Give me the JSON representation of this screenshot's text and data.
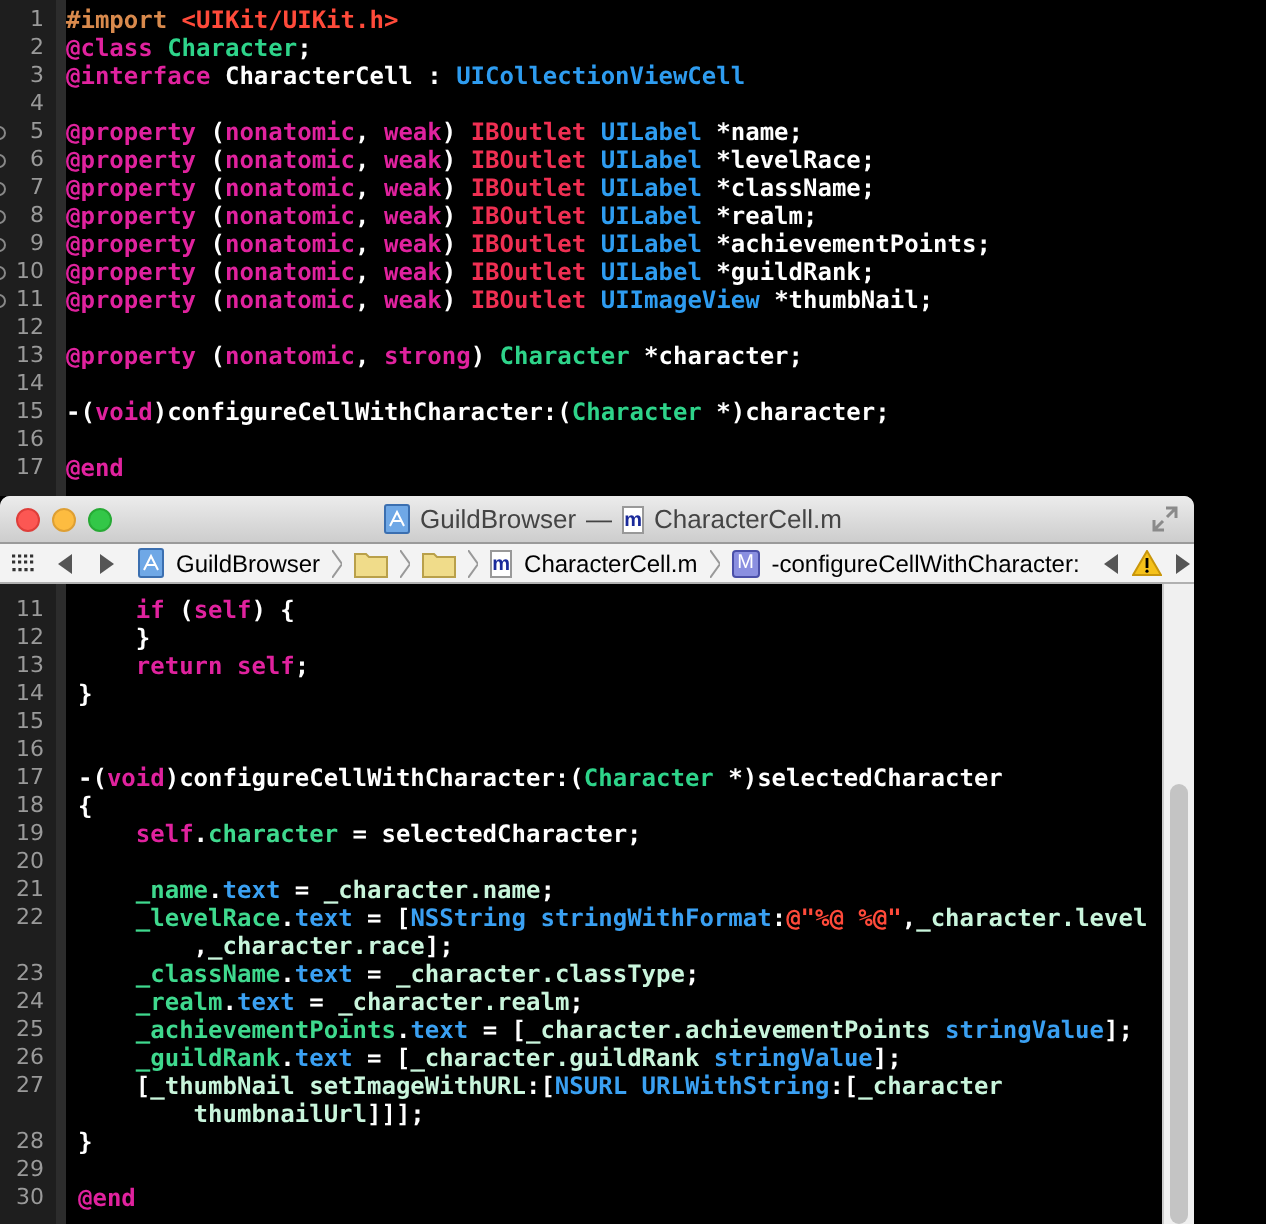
{
  "header_editor": {
    "lines": [
      {
        "n": "1",
        "segs": [
          {
            "text": "#import ",
            "kind": "d"
          },
          {
            "text": "<UIKit/UIKit.h>",
            "kind": "s"
          }
        ]
      },
      {
        "n": "2",
        "segs": [
          {
            "text": "@class ",
            "kind": "k"
          },
          {
            "text": "Character",
            "kind": "p"
          },
          {
            "text": ";",
            "kind": "t"
          }
        ]
      },
      {
        "n": "3",
        "segs": [
          {
            "text": "@interface",
            "kind": "k"
          },
          {
            "text": " CharacterCell : ",
            "kind": "t"
          },
          {
            "text": "UICollectionViewCell",
            "kind": "c"
          }
        ]
      },
      {
        "n": "4"
      },
      {
        "n": "5",
        "outlet": true,
        "segs": [
          {
            "text": "@property",
            "kind": "k"
          },
          {
            "text": " (",
            "kind": "t"
          },
          {
            "text": "nonatomic",
            "kind": "k"
          },
          {
            "text": ", ",
            "kind": "t"
          },
          {
            "text": "weak",
            "kind": "k"
          },
          {
            "text": ") ",
            "kind": "t"
          },
          {
            "text": "IBOutlet ",
            "kind": "o"
          },
          {
            "text": "UILabel",
            "kind": "c"
          },
          {
            "text": " *name;",
            "kind": "t"
          }
        ]
      },
      {
        "n": "6",
        "outlet": true,
        "segs": [
          {
            "text": "@property",
            "kind": "k"
          },
          {
            "text": " (",
            "kind": "t"
          },
          {
            "text": "nonatomic",
            "kind": "k"
          },
          {
            "text": ", ",
            "kind": "t"
          },
          {
            "text": "weak",
            "kind": "k"
          },
          {
            "text": ") ",
            "kind": "t"
          },
          {
            "text": "IBOutlet ",
            "kind": "o"
          },
          {
            "text": "UILabel",
            "kind": "c"
          },
          {
            "text": " *levelRace;",
            "kind": "t"
          }
        ]
      },
      {
        "n": "7",
        "outlet": true,
        "segs": [
          {
            "text": "@property",
            "kind": "k"
          },
          {
            "text": " (",
            "kind": "t"
          },
          {
            "text": "nonatomic",
            "kind": "k"
          },
          {
            "text": ", ",
            "kind": "t"
          },
          {
            "text": "weak",
            "kind": "k"
          },
          {
            "text": ") ",
            "kind": "t"
          },
          {
            "text": "IBOutlet ",
            "kind": "o"
          },
          {
            "text": "UILabel",
            "kind": "c"
          },
          {
            "text": " *className;",
            "kind": "t"
          }
        ]
      },
      {
        "n": "8",
        "outlet": true,
        "segs": [
          {
            "text": "@property",
            "kind": "k"
          },
          {
            "text": " (",
            "kind": "t"
          },
          {
            "text": "nonatomic",
            "kind": "k"
          },
          {
            "text": ", ",
            "kind": "t"
          },
          {
            "text": "weak",
            "kind": "k"
          },
          {
            "text": ") ",
            "kind": "t"
          },
          {
            "text": "IBOutlet ",
            "kind": "o"
          },
          {
            "text": "UILabel",
            "kind": "c"
          },
          {
            "text": " *realm;",
            "kind": "t"
          }
        ]
      },
      {
        "n": "9",
        "outlet": true,
        "segs": [
          {
            "text": "@property",
            "kind": "k"
          },
          {
            "text": " (",
            "kind": "t"
          },
          {
            "text": "nonatomic",
            "kind": "k"
          },
          {
            "text": ", ",
            "kind": "t"
          },
          {
            "text": "weak",
            "kind": "k"
          },
          {
            "text": ") ",
            "kind": "t"
          },
          {
            "text": "IBOutlet ",
            "kind": "o"
          },
          {
            "text": "UILabel",
            "kind": "c"
          },
          {
            "text": " *achievementPoints;",
            "kind": "t"
          }
        ]
      },
      {
        "n": "10",
        "outlet": true,
        "segs": [
          {
            "text": "@property",
            "kind": "k"
          },
          {
            "text": " (",
            "kind": "t"
          },
          {
            "text": "nonatomic",
            "kind": "k"
          },
          {
            "text": ", ",
            "kind": "t"
          },
          {
            "text": "weak",
            "kind": "k"
          },
          {
            "text": ") ",
            "kind": "t"
          },
          {
            "text": "IBOutlet ",
            "kind": "o"
          },
          {
            "text": "UILabel",
            "kind": "c"
          },
          {
            "text": " *guildRank;",
            "kind": "t"
          }
        ]
      },
      {
        "n": "11",
        "outlet": true,
        "segs": [
          {
            "text": "@property",
            "kind": "k"
          },
          {
            "text": " (",
            "kind": "t"
          },
          {
            "text": "nonatomic",
            "kind": "k"
          },
          {
            "text": ", ",
            "kind": "t"
          },
          {
            "text": "weak",
            "kind": "k"
          },
          {
            "text": ") ",
            "kind": "t"
          },
          {
            "text": "IBOutlet ",
            "kind": "o"
          },
          {
            "text": "UIImageView",
            "kind": "c"
          },
          {
            "text": " *thumbNail;",
            "kind": "t"
          }
        ]
      },
      {
        "n": "12"
      },
      {
        "n": "13",
        "segs": [
          {
            "text": "@property",
            "kind": "k"
          },
          {
            "text": " (",
            "kind": "t"
          },
          {
            "text": "nonatomic",
            "kind": "k"
          },
          {
            "text": ", ",
            "kind": "t"
          },
          {
            "text": "strong",
            "kind": "k"
          },
          {
            "text": ") ",
            "kind": "t"
          },
          {
            "text": "Character",
            "kind": "p"
          },
          {
            "text": " *character;",
            "kind": "t"
          }
        ]
      },
      {
        "n": "14"
      },
      {
        "n": "15",
        "segs": [
          {
            "text": "-(",
            "kind": "t"
          },
          {
            "text": "void",
            "kind": "k"
          },
          {
            "text": ")configureCellWithCharacter:(",
            "kind": "t"
          },
          {
            "text": "Character",
            "kind": "p"
          },
          {
            "text": " *)character;",
            "kind": "t"
          }
        ]
      },
      {
        "n": "16"
      },
      {
        "n": "17",
        "segs": [
          {
            "text": "@end",
            "kind": "k"
          }
        ]
      }
    ]
  },
  "window": {
    "title_project": "GuildBrowser",
    "title_separator": "—",
    "title_file_badge": "m",
    "title_file": "CharacterCell.m",
    "jump_bar": [
      {
        "kind": "project",
        "label": "GuildBrowser"
      },
      {
        "kind": "folder"
      },
      {
        "kind": "folder"
      },
      {
        "kind": "file",
        "badge": "m",
        "label": "CharacterCell.m"
      },
      {
        "kind": "method",
        "badge": "M",
        "label": "-configureCellWithCharacter:"
      }
    ],
    "lines": [
      {
        "n": "11",
        "segs": [
          {
            "text": "    if",
            "kind": "k"
          },
          {
            "text": " (",
            "kind": "t"
          },
          {
            "text": "self",
            "kind": "k"
          },
          {
            "text": ") {",
            "kind": "t"
          }
        ]
      },
      {
        "n": "12",
        "segs": [
          {
            "text": "    }",
            "kind": "t"
          }
        ]
      },
      {
        "n": "13",
        "segs": [
          {
            "text": "    return self",
            "kind": "k"
          },
          {
            "text": ";",
            "kind": "t"
          }
        ]
      },
      {
        "n": "14",
        "segs": [
          {
            "text": "}",
            "kind": "t"
          }
        ]
      },
      {
        "n": "15"
      },
      {
        "n": "16"
      },
      {
        "n": "17",
        "segs": [
          {
            "text": "-(",
            "kind": "t"
          },
          {
            "text": "void",
            "kind": "k"
          },
          {
            "text": ")configureCellWithCharacter:(",
            "kind": "t"
          },
          {
            "text": "Character",
            "kind": "p"
          },
          {
            "text": " *)selectedCharacter",
            "kind": "t"
          }
        ]
      },
      {
        "n": "18",
        "segs": [
          {
            "text": "{",
            "kind": "t"
          }
        ]
      },
      {
        "n": "19",
        "segs": [
          {
            "text": "    self",
            "kind": "k"
          },
          {
            "text": ".",
            "kind": "t"
          },
          {
            "text": "character",
            "kind": "i"
          },
          {
            "text": " = selectedCharacter;",
            "kind": "t"
          }
        ]
      },
      {
        "n": "20"
      },
      {
        "n": "21",
        "segs": [
          {
            "text": "    _name",
            "kind": "i"
          },
          {
            "text": ".",
            "kind": "t"
          },
          {
            "text": "text",
            "kind": "m"
          },
          {
            "text": " = ",
            "kind": "t"
          },
          {
            "text": "_character.name",
            "kind": "v"
          },
          {
            "text": ";",
            "kind": "t"
          }
        ]
      },
      {
        "n": "22",
        "segs": [
          {
            "text": "    _levelRace",
            "kind": "i"
          },
          {
            "text": ".",
            "kind": "t"
          },
          {
            "text": "text",
            "kind": "m"
          },
          {
            "text": " = [",
            "kind": "t"
          },
          {
            "text": "NSString stringWithFormat",
            "kind": "m"
          },
          {
            "text": ":",
            "kind": "t"
          },
          {
            "text": "@\"%@ %@\"",
            "kind": "s"
          },
          {
            "text": ",",
            "kind": "t"
          },
          {
            "text": "_character.level",
            "kind": "v"
          }
        ],
        "cont": [
          {
            "text": "        ,",
            "kind": "t"
          },
          {
            "text": "_character.race",
            "kind": "v"
          },
          {
            "text": "];",
            "kind": "t"
          }
        ]
      },
      {
        "n": "23",
        "segs": [
          {
            "text": "    _className",
            "kind": "i"
          },
          {
            "text": ".",
            "kind": "t"
          },
          {
            "text": "text",
            "kind": "m"
          },
          {
            "text": " = ",
            "kind": "t"
          },
          {
            "text": "_character.classType",
            "kind": "v"
          },
          {
            "text": ";",
            "kind": "t"
          }
        ]
      },
      {
        "n": "24",
        "segs": [
          {
            "text": "    _realm",
            "kind": "i"
          },
          {
            "text": ".",
            "kind": "t"
          },
          {
            "text": "text",
            "kind": "m"
          },
          {
            "text": " = ",
            "kind": "t"
          },
          {
            "text": "_character.realm",
            "kind": "v"
          },
          {
            "text": ";",
            "kind": "t"
          }
        ]
      },
      {
        "n": "25",
        "segs": [
          {
            "text": "    _achievementPoints",
            "kind": "i"
          },
          {
            "text": ".",
            "kind": "t"
          },
          {
            "text": "text",
            "kind": "m"
          },
          {
            "text": " = [",
            "kind": "t"
          },
          {
            "text": "_character.achievementPoints ",
            "kind": "v"
          },
          {
            "text": "stringValue",
            "kind": "m"
          },
          {
            "text": "];",
            "kind": "t"
          }
        ]
      },
      {
        "n": "26",
        "segs": [
          {
            "text": "    _guildRank",
            "kind": "i"
          },
          {
            "text": ".",
            "kind": "t"
          },
          {
            "text": "text",
            "kind": "m"
          },
          {
            "text": " = [",
            "kind": "t"
          },
          {
            "text": "_character.guildRank ",
            "kind": "v"
          },
          {
            "text": "stringValue",
            "kind": "m"
          },
          {
            "text": "];",
            "kind": "t"
          }
        ]
      },
      {
        "n": "27",
        "segs": [
          {
            "text": "    [",
            "kind": "t"
          },
          {
            "text": "_thumbNail setImageWithURL",
            "kind": "v"
          },
          {
            "text": ":[",
            "kind": "t"
          },
          {
            "text": "NSURL URLWithString",
            "kind": "m"
          },
          {
            "text": ":[",
            "kind": "t"
          },
          {
            "text": "_character",
            "kind": "v"
          }
        ],
        "cont": [
          {
            "text": "        thumbnailUrl",
            "kind": "v"
          },
          {
            "text": "]]];",
            "kind": "t"
          }
        ]
      },
      {
        "n": "28",
        "segs": [
          {
            "text": "}",
            "kind": "t"
          }
        ]
      },
      {
        "n": "29"
      },
      {
        "n": "30",
        "segs": [
          {
            "text": "@end",
            "kind": "k"
          }
        ]
      }
    ]
  }
}
